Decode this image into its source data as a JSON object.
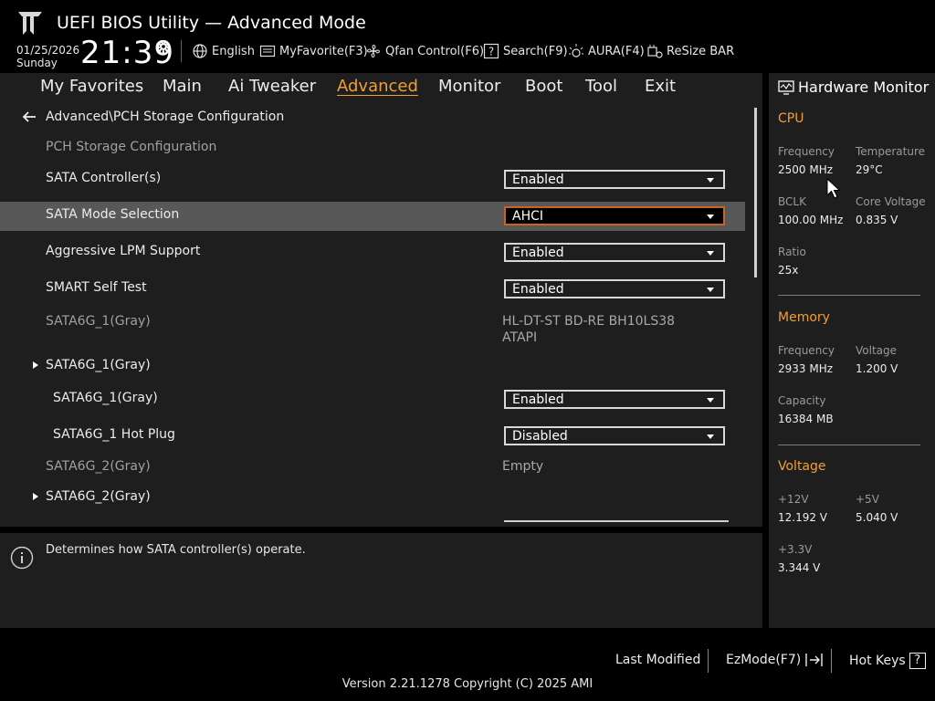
{
  "header": {
    "title": "UEFI BIOS Utility — Advanced Mode",
    "date": "01/25/2026",
    "day": "Sunday",
    "time": "21:39",
    "tools": [
      {
        "label": "English",
        "icon": "globe-icon"
      },
      {
        "label": "MyFavorite(F3)",
        "icon": "favorite-icon"
      },
      {
        "label": "Qfan Control(F6)",
        "icon": "fan-icon"
      },
      {
        "label": "Search(F9)",
        "icon": "search-icon"
      },
      {
        "label": "AURA(F4)",
        "icon": "aura-icon"
      },
      {
        "label": "ReSize BAR",
        "icon": "resize-bar-icon"
      }
    ]
  },
  "nav": {
    "tabs": [
      {
        "label": "My Favorites"
      },
      {
        "label": "Main"
      },
      {
        "label": "Ai Tweaker"
      },
      {
        "label": "Advanced",
        "active": true
      },
      {
        "label": "Monitor"
      },
      {
        "label": "Boot"
      },
      {
        "label": "Tool"
      },
      {
        "label": "Exit"
      }
    ]
  },
  "main": {
    "breadcrumb": "Advanced\\PCH Storage Configuration",
    "section_title": "PCH Storage Configuration",
    "rows": {
      "sata_controller": {
        "label": "SATA Controller(s)",
        "value": "Enabled"
      },
      "sata_mode": {
        "label": "SATA Mode Selection",
        "value": "AHCI"
      },
      "aggressive_lpm": {
        "label": "Aggressive LPM Support",
        "value": "Enabled"
      },
      "smart_self_test": {
        "label": "SMART Self Test",
        "value": "Enabled"
      },
      "sata6g_1_info": {
        "label": "SATA6G_1(Gray)",
        "value_line1": "HL-DT-ST BD-RE  BH10LS38",
        "value_line2": "ATAPI"
      },
      "sata6g_1_submenu": {
        "label": "SATA6G_1(Gray)"
      },
      "sata6g_1_enable": {
        "label": "SATA6G_1(Gray)",
        "value": "Enabled"
      },
      "sata6g_1_hotplug": {
        "label": "SATA6G_1 Hot Plug",
        "value": "Disabled"
      },
      "sata6g_2_info": {
        "label": "SATA6G_2(Gray)",
        "value": "Empty"
      },
      "sata6g_2_submenu": {
        "label": "SATA6G_2(Gray)"
      }
    }
  },
  "help": {
    "text": "Determines how SATA controller(s) operate."
  },
  "hwmon": {
    "title": "Hardware Monitor",
    "cpu": {
      "section": "CPU",
      "frequency_label": "Frequency",
      "frequency": "2500 MHz",
      "temperature_label": "Temperature",
      "temperature": "29°C",
      "bclk_label": "BCLK",
      "bclk": "100.00 MHz",
      "core_voltage_label": "Core Voltage",
      "core_voltage": "0.835 V",
      "ratio_label": "Ratio",
      "ratio": "25x"
    },
    "memory": {
      "section": "Memory",
      "frequency_label": "Frequency",
      "frequency": "2933 MHz",
      "voltage_label": "Voltage",
      "voltage": "1.200 V",
      "capacity_label": "Capacity",
      "capacity": "16384 MB"
    },
    "voltage": {
      "section": "Voltage",
      "v12_label": "+12V",
      "v12": "12.192 V",
      "v5_label": "+5V",
      "v5": "5.040 V",
      "v33_label": "+3.3V",
      "v33": "3.344 V"
    }
  },
  "footer": {
    "last_modified": "Last Modified",
    "ezmode": "EzMode(F7)",
    "hot_keys": "Hot Keys",
    "hot_keys_glyph": "?",
    "version": "Version 2.21.1278 Copyright (C) 2025 AMI"
  },
  "colors": {
    "accent": "#f0a030",
    "focus_border": "#c8641e",
    "panel": "#1e1e1e",
    "highlight_row": "#585858"
  }
}
